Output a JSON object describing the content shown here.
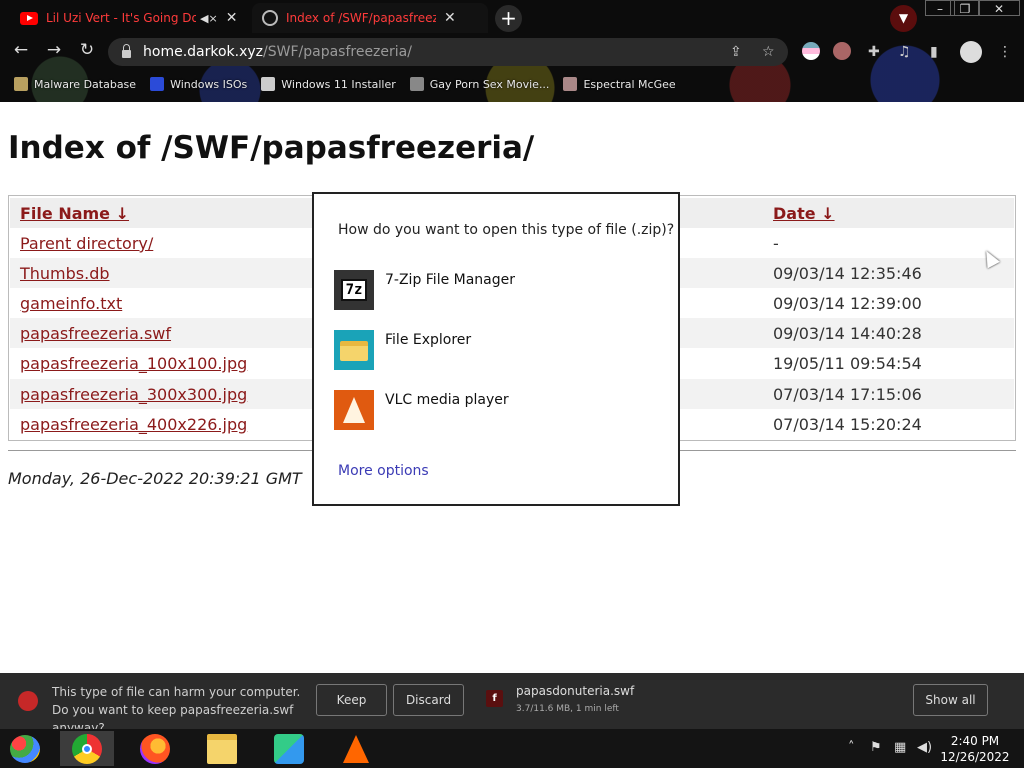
{
  "browser": {
    "tabs": [
      {
        "title": "Lil Uzi Vert - It's Going Down",
        "icon": "youtube-icon",
        "muted": true
      },
      {
        "title": "Index of /SWF/papasfreezeria/",
        "icon": "globe-icon",
        "active": true
      }
    ],
    "new_tab": "+",
    "url_host": "home.darkok.xyz",
    "url_path": "/SWF/papasfreezeria/",
    "bookmarks": [
      "Malware Database",
      "Windows ISOs",
      "Windows 11 Installer",
      "Gay Porn Sex Movie...",
      "Espectral McGee"
    ]
  },
  "page": {
    "title": "Index of /SWF/papasfreezeria/",
    "columns": {
      "name": "File Name  ↓",
      "date": "Date  ↓"
    },
    "rows": [
      {
        "name": "Parent directory/",
        "date": "-"
      },
      {
        "name": "Thumbs.db",
        "date": "09/03/14 12:35:46"
      },
      {
        "name": "gameinfo.txt",
        "date": "09/03/14 12:39:00"
      },
      {
        "name": "papasfreezeria.swf",
        "date": "09/03/14 14:40:28"
      },
      {
        "name": "papasfreezeria_100x100.jpg",
        "date": "19/05/11 09:54:54"
      },
      {
        "name": "papasfreezeria_300x300.jpg",
        "date": "07/03/14 17:15:06"
      },
      {
        "name": "papasfreezeria_400x226.jpg",
        "date": "07/03/14 15:20:24"
      }
    ],
    "footer": "Monday, 26-Dec-2022 20:39:21 GMT"
  },
  "open_with_dialog": {
    "title": "How do you want to open this type of file (.zip)?",
    "options": [
      {
        "label": "7-Zip File Manager",
        "icon": "7zip-icon"
      },
      {
        "label": "File Explorer",
        "icon": "file-explorer-icon"
      },
      {
        "label": "VLC media player",
        "icon": "vlc-icon"
      }
    ],
    "more": "More options"
  },
  "download_bar": {
    "warning": "This type of file can harm your computer. Do you want to keep papasfreezeria.swf anyway?",
    "keep": "Keep",
    "discard": "Discard",
    "file_name": "papasdonuteria.swf",
    "file_status": "3.7/11.6 MB, 1 min left",
    "show_all": "Show all"
  },
  "taskbar": {
    "time": "2:40 PM",
    "date": "12/26/2022"
  },
  "colors": {
    "link": "#8b1a1a",
    "tab_text": "#ff3b3b",
    "dialog_link": "#3b3bb5"
  }
}
